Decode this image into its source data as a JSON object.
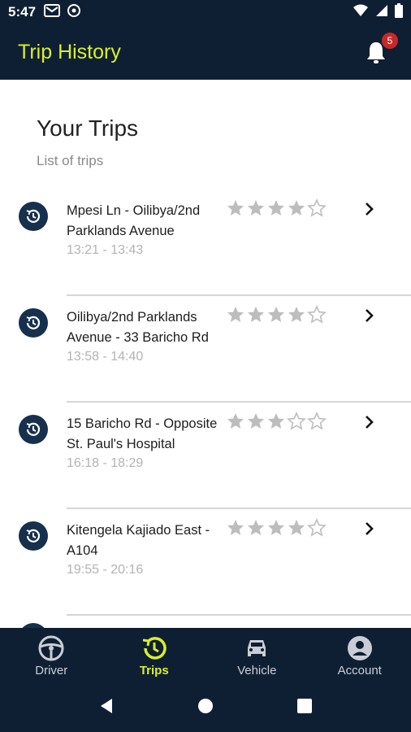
{
  "status_bar": {
    "time": "5:47"
  },
  "app_bar": {
    "title": "Trip History",
    "notification_count": "5"
  },
  "page": {
    "heading": "Your Trips",
    "subheading": "List of trips"
  },
  "trips": [
    {
      "route": "Mpesi Ln - Oilibya/2nd Parklands Avenue",
      "time": "13:21 - 13:43",
      "rating": 4,
      "max_rating": 5
    },
    {
      "route": "Oilibya/2nd Parklands Avenue - 33 Baricho Rd",
      "time": "13:58 - 14:40",
      "rating": 4,
      "max_rating": 5
    },
    {
      "route": "15 Baricho Rd - Opposite St. Paul's Hospital",
      "time": "16:18 - 18:29",
      "rating": 3,
      "max_rating": 5
    },
    {
      "route": "Kitengela Kajiado East - A104",
      "time": "19:55 - 20:16",
      "rating": 4,
      "max_rating": 5
    }
  ],
  "bottom_nav": [
    {
      "label": "Driver",
      "icon": "steering-wheel-icon",
      "active": false
    },
    {
      "label": "Trips",
      "icon": "history-icon",
      "active": true
    },
    {
      "label": "Vehicle",
      "icon": "car-icon",
      "active": false
    },
    {
      "label": "Account",
      "icon": "account-icon",
      "active": false
    }
  ],
  "colors": {
    "primary_dark": "#0f1f33",
    "accent": "#d9ef2b",
    "badge": "#c62828",
    "star_filled": "#bdbdbd",
    "history_circle": "#16304d"
  }
}
